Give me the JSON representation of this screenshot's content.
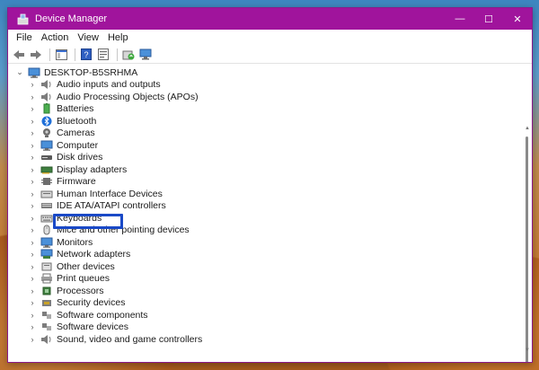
{
  "window": {
    "title": "Device Manager",
    "controls": {
      "minimize": "—",
      "maximize": "☐",
      "close": "✕"
    }
  },
  "menu": [
    "File",
    "Action",
    "View",
    "Help"
  ],
  "toolbar": [
    "back-icon",
    "forward-icon",
    "show-hide-console-tree-icon",
    "help-icon",
    "properties-icon",
    "update-driver-icon",
    "scan-hardware-icon"
  ],
  "tree": {
    "root": "DESKTOP-B5SRHMA",
    "items": [
      {
        "label": "Audio inputs and outputs",
        "icon": "speaker-icon"
      },
      {
        "label": "Audio Processing Objects (APOs)",
        "icon": "speaker-icon"
      },
      {
        "label": "Batteries",
        "icon": "battery-icon"
      },
      {
        "label": "Bluetooth",
        "icon": "bluetooth-icon"
      },
      {
        "label": "Cameras",
        "icon": "camera-icon"
      },
      {
        "label": "Computer",
        "icon": "computer-icon"
      },
      {
        "label": "Disk drives",
        "icon": "disk-drive-icon"
      },
      {
        "label": "Display adapters",
        "icon": "display-adapter-icon"
      },
      {
        "label": "Firmware",
        "icon": "firmware-icon"
      },
      {
        "label": "Human Interface Devices",
        "icon": "hid-icon"
      },
      {
        "label": "IDE ATA/ATAPI controllers",
        "icon": "ide-controller-icon"
      },
      {
        "label": "Keyboards",
        "icon": "keyboard-icon"
      },
      {
        "label": "Mice and other pointing devices",
        "icon": "mouse-icon"
      },
      {
        "label": "Monitors",
        "icon": "monitor-icon"
      },
      {
        "label": "Network adapters",
        "icon": "network-adapter-icon"
      },
      {
        "label": "Other devices",
        "icon": "other-devices-icon"
      },
      {
        "label": "Print queues",
        "icon": "printer-icon"
      },
      {
        "label": "Processors",
        "icon": "processor-icon"
      },
      {
        "label": "Security devices",
        "icon": "security-icon"
      },
      {
        "label": "Software components",
        "icon": "software-component-icon"
      },
      {
        "label": "Software devices",
        "icon": "software-device-icon"
      },
      {
        "label": "Sound, video and game controllers",
        "icon": "sound-controller-icon"
      }
    ]
  },
  "colors": {
    "titlebar": "#a0149c",
    "highlight": "#1a49c7"
  }
}
